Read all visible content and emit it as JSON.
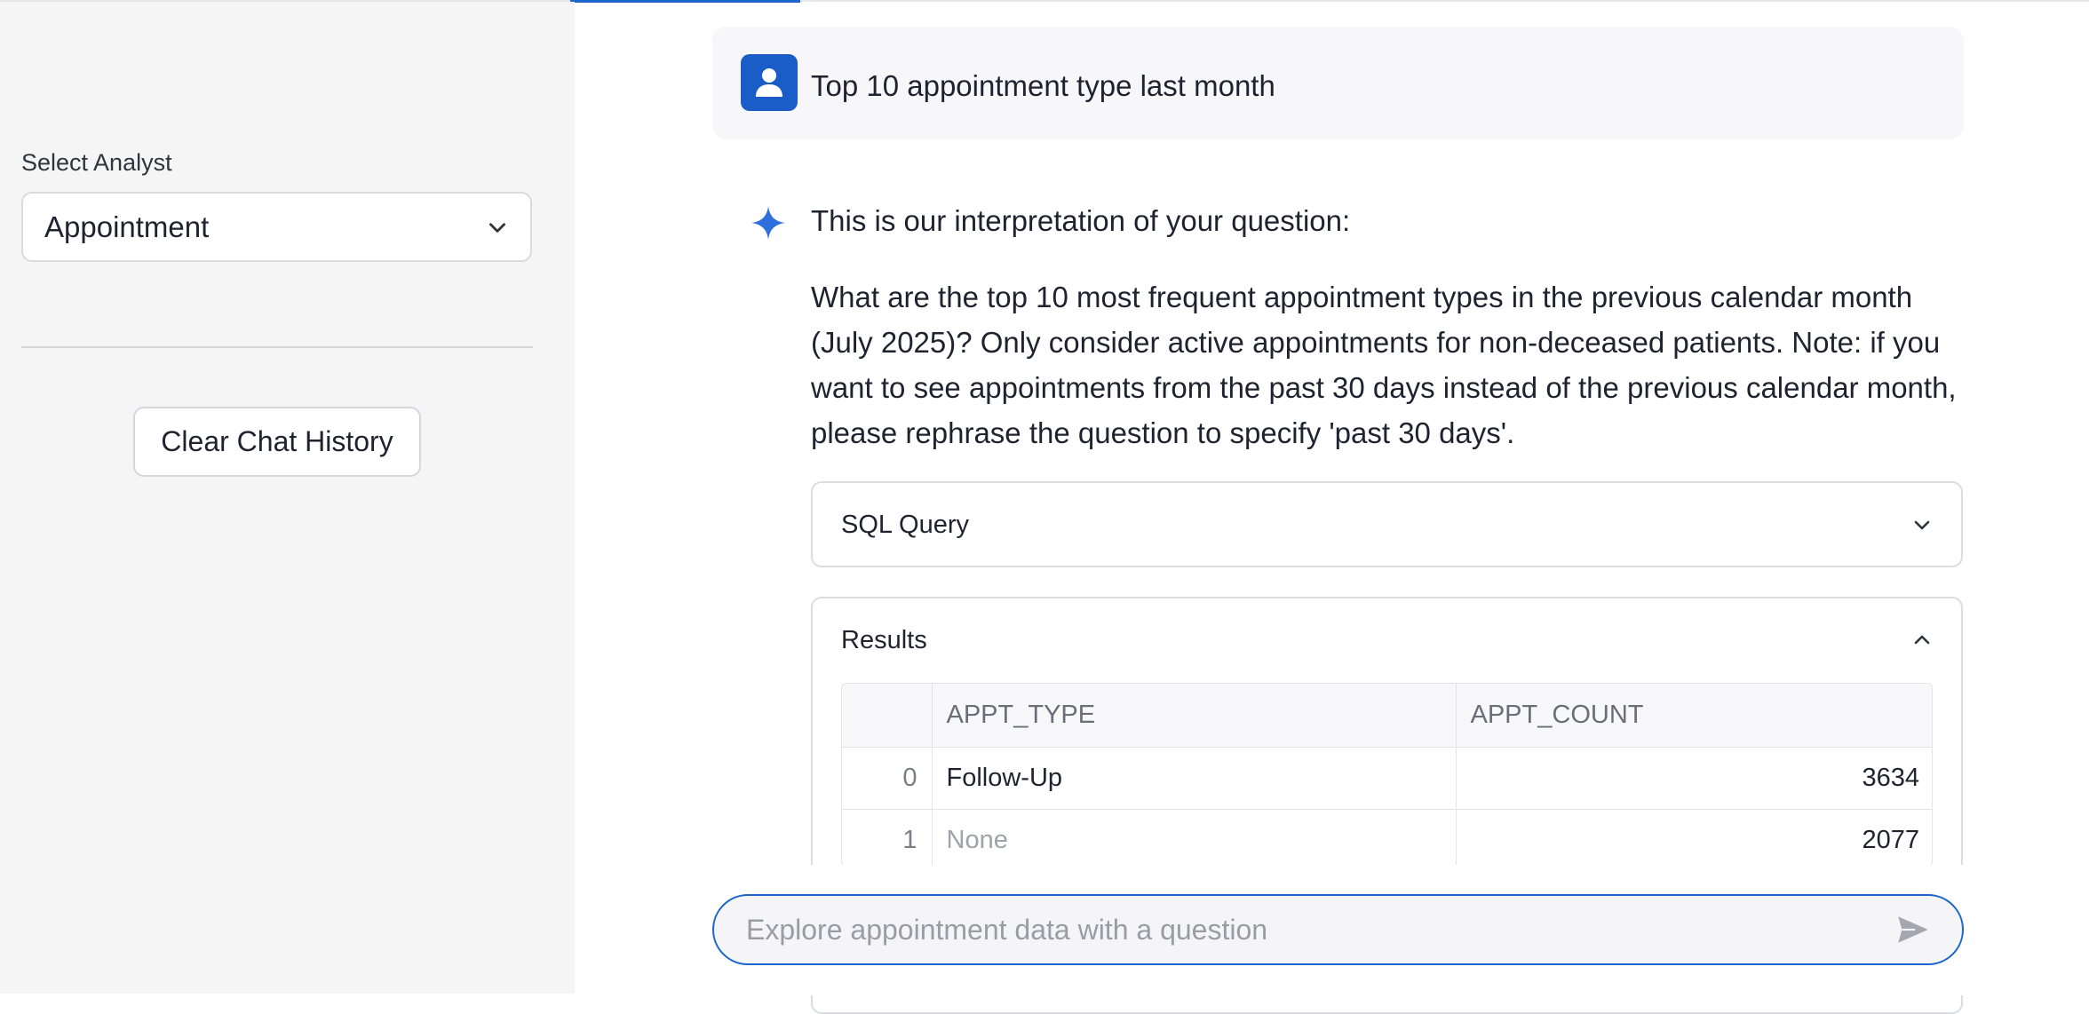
{
  "sidebar": {
    "select_label": "Select Analyst",
    "selected_analyst": "Appointment",
    "clear_button": "Clear Chat History"
  },
  "chat": {
    "user_message": "Top 10 appointment type last month",
    "assistant_header": "This is our interpretation of your question:",
    "assistant_interpretation": "What are the top 10 most frequent appointment types in the previous calendar month (July 2025)? Only consider active appointments for non-deceased patients. Note: if you want to see appointments from the past 30 days instead of the previous calendar month, please rephrase the question to specify 'past 30 days'.",
    "sql_expander_title": "SQL Query",
    "results_expander_title": "Results",
    "results": {
      "columns": [
        "",
        "APPT_TYPE",
        "APPT_COUNT"
      ],
      "rows": [
        {
          "index": "0",
          "appt_type": "Follow-Up",
          "appt_count": "3634"
        },
        {
          "index": "1",
          "appt_type": "None",
          "appt_count": "2077"
        }
      ]
    },
    "input_placeholder": "Explore appointment data with a question"
  },
  "colors": {
    "accent": "#1a66cc",
    "avatar": "#1a5cc8",
    "sidebar_bg": "#f5f5f6"
  },
  "icons": {
    "avatar": "user-icon",
    "assistant": "sparkle-icon",
    "send": "send-icon"
  }
}
